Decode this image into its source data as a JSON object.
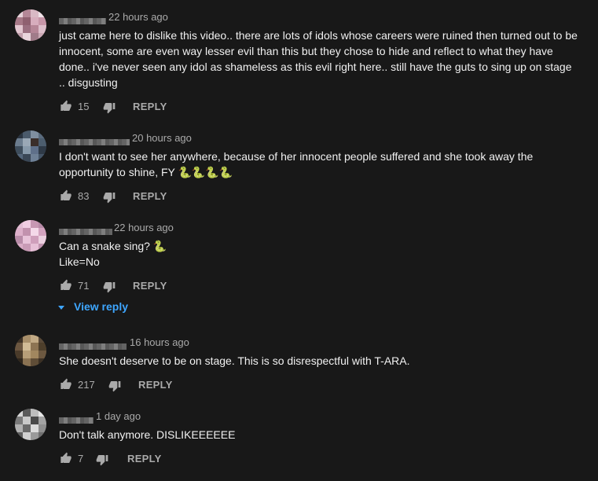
{
  "comments": [
    {
      "time": "22 hours ago",
      "text": "just came here to dislike this video.. there are lots of idols whose careers were ruined then turned out to be innocent, some are even way lesser evil than this but they chose to hide and reflect to what they have done.. i've never seen any idol as shameless as this evil right here.. still have the guts to sing up on stage .. disgusting",
      "likes": "15",
      "reply_label": "REPLY",
      "avatar_colors": [
        "#c9a5b0",
        "#e0c7cf",
        "#8f6e7a",
        "#d8b6c2"
      ]
    },
    {
      "time": "20 hours ago",
      "text": "I don't want to see her anywhere, because of her innocent people suffered and she took away the opportunity to shine, FY",
      "emoji": "🐍🐍🐍🐍",
      "likes": "83",
      "reply_label": "REPLY",
      "avatar_colors": [
        "#3c4a58",
        "#5a6b7d",
        "#2a3440",
        "#7f8fa0"
      ]
    },
    {
      "time": "22 hours ago",
      "text_line1": "Can a snake sing?",
      "emoji": "🐍",
      "text_line2": "Like=No",
      "likes": "71",
      "reply_label": "REPLY",
      "view_reply": "View reply",
      "avatar_colors": [
        "#d7a7c3",
        "#f0cde2",
        "#b68aa6",
        "#e2bdd4"
      ]
    },
    {
      "time": "16 hours ago",
      "text": "She doesn't deserve to be on stage. This is so disrespectful with T-ARA.",
      "likes": "217",
      "reply_label": "REPLY",
      "avatar_colors": [
        "#7a6548",
        "#a88f6a",
        "#4e3f2b",
        "#c2aa85"
      ]
    },
    {
      "time": "1 day ago",
      "text": "Don't talk anymore. DISLIKEEEEEE",
      "likes": "7",
      "reply_label": "REPLY",
      "avatar_colors": [
        "#8c8c8c",
        "#bdbdbd",
        "#5a5a5a",
        "#d6d6d6"
      ]
    }
  ]
}
